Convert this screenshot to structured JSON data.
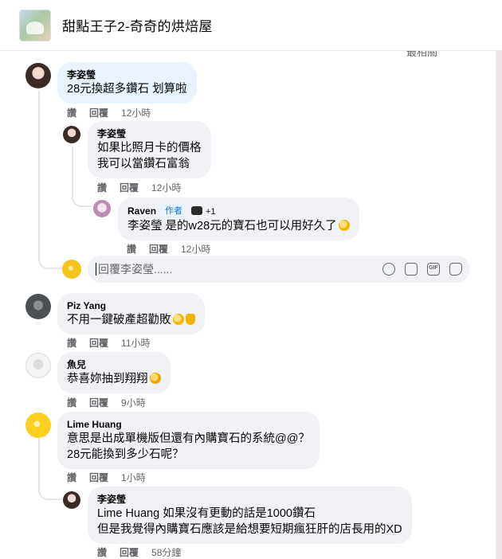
{
  "header": {
    "title": "甜點王子2-奇奇的烘焙屋",
    "sort_label": "最相關",
    "sort_chevron": "▾"
  },
  "actions": {
    "like": "讚",
    "reply": "回覆"
  },
  "comments": [
    {
      "author": "李姿瑩",
      "lines": [
        "28元換超多鑽石 划算啦"
      ],
      "time": "12小時"
    },
    {
      "author": "李姿瑩",
      "lines": [
        "如果比照月卡的價格",
        "我可以當鑽石富翁"
      ],
      "time": "12小時"
    },
    {
      "author": "Raven",
      "author_tag": "作者",
      "badge_count": "+1",
      "mention": "李姿瑩",
      "text": " 是的w28元的寶石也可以用好久了",
      "time": "12小時"
    },
    {
      "author": "Piz Yang",
      "lines": [
        "不用一鍵破產超勸敗"
      ],
      "time": "11小時"
    },
    {
      "author": "魚兒",
      "lines": [
        "恭喜妳抽到翔翔"
      ],
      "time": "9小時"
    },
    {
      "author": "Lime Huang",
      "lines": [
        "意思是出成單機版但還有內購寶石的系統@@？",
        "28元能換到多少石呢？"
      ],
      "time": "1小時"
    },
    {
      "author": "李姿瑩",
      "mention": "Lime Huang",
      "text": " 如果沒有更動的話是1000鑽石",
      "line2": "但是我覺得內購寶石應該是給想要短期瘋狂肝的店長用的XD",
      "time": "58分鐘"
    }
  ],
  "reply_box": {
    "placeholder": "回覆李姿瑩......"
  },
  "icons": {
    "emoji": "emoji-icon",
    "camera": "camera-icon",
    "gif": "gif-icon",
    "sticker": "sticker-icon",
    "gif_label": "GIF"
  },
  "colors": {
    "bubble": "#f0f2f5",
    "highlight_bubble": "#e7f3ff",
    "author_tag": "#1b74e4",
    "meta": "#65676b"
  }
}
